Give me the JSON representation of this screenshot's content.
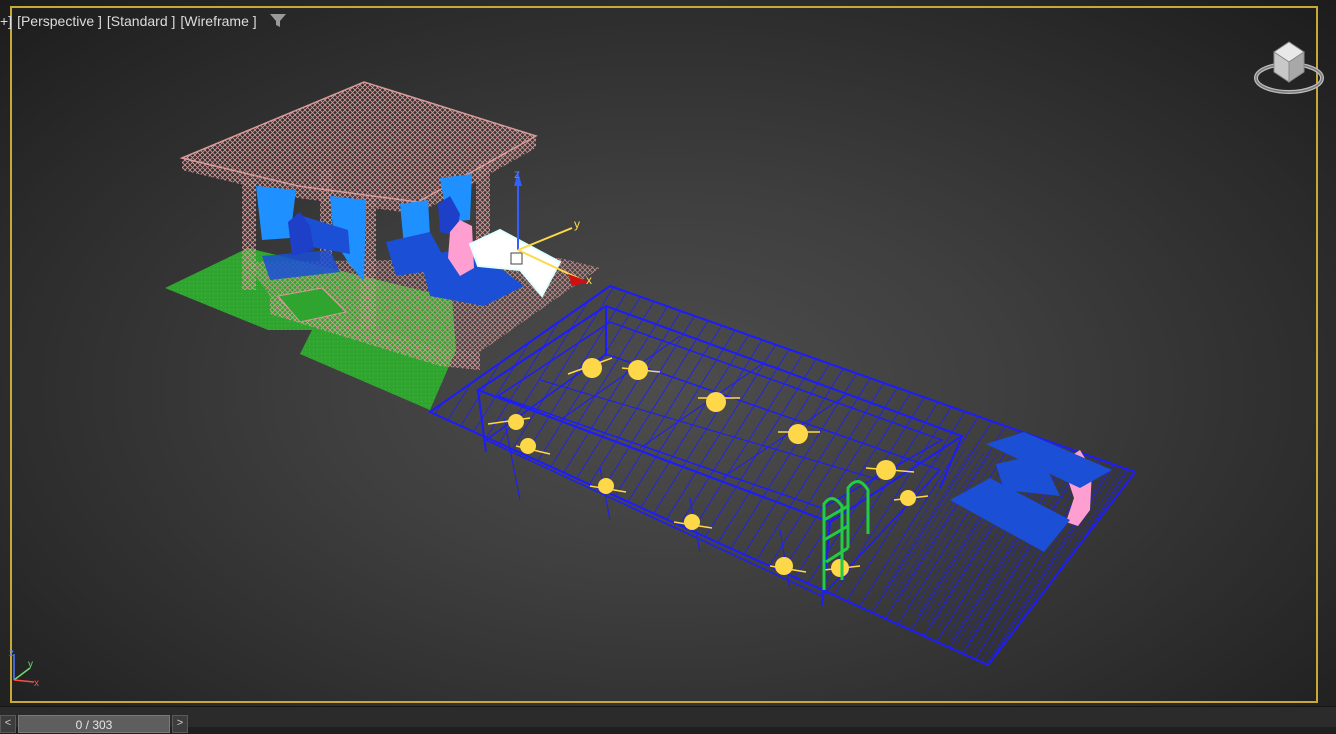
{
  "viewport": {
    "label_prefix": "+]",
    "label_view": "[Perspective ]",
    "label_shading": "[Standard ]",
    "label_mode": "[Wireframe ]",
    "filter_icon": "filter-icon",
    "colors": {
      "active_border": "#c8a83a",
      "gazebo_wire": "#d99a9a",
      "grass": "#2fa52f",
      "deck_wire": "#1c1cff",
      "furniture": "#1a4fd6",
      "curtains": "#1e90ff",
      "lights": "#ffd84a",
      "ladder": "#22cc44",
      "plants": "#ff9ed0",
      "selected_lounger": "#ffffff"
    }
  },
  "gizmo": {
    "z_label": "z",
    "y_label": "y",
    "x_label": "x"
  },
  "corner_axis": {
    "z_label": "z",
    "y_label": "y",
    "x_label": "x"
  },
  "timebar": {
    "prev_label": "<",
    "frame_display": "0 / 303",
    "next_label": ">"
  }
}
